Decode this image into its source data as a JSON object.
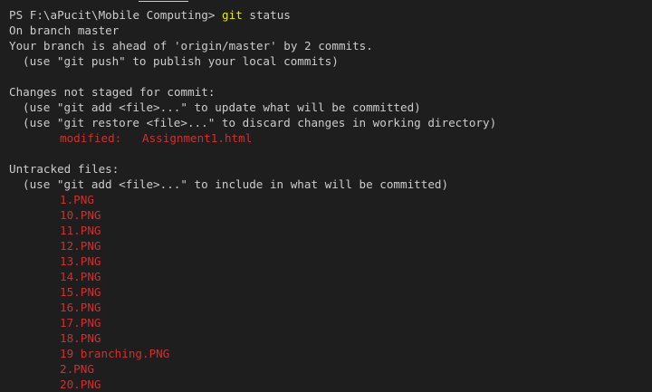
{
  "terminal": {
    "prompt": "PS F:\\aPucit\\Mobile Computing> ",
    "command": "git",
    "command_args": " status",
    "branch_line": "On branch master",
    "ahead_line": "Your branch is ahead of 'origin/master' by 2 commits.",
    "push_hint": "(use \"git push\" to publish your local commits)",
    "not_staged_header": "Changes not staged for commit:",
    "not_staged_hint_add": "(use \"git add <file>...\" to update what will be committed)",
    "not_staged_hint_restore": "(use \"git restore <file>...\" to discard changes in working directory)",
    "modified_entry": "modified:   Assignment1.html",
    "untracked_header": "Untracked files:",
    "untracked_hint": "(use \"git add <file>...\" to include in what will be committed)",
    "untracked_files": [
      "1.PNG",
      "10.PNG",
      "11.PNG",
      "12.PNG",
      "13.PNG",
      "14.PNG",
      "15.PNG",
      "16.PNG",
      "17.PNG",
      "18.PNG",
      "19 branching.PNG",
      "2.PNG",
      "20.PNG"
    ],
    "colors": {
      "background": "#1e1e1e",
      "text": "#cccccc",
      "command": "#e5e510",
      "file_status": "#cd3131"
    }
  }
}
